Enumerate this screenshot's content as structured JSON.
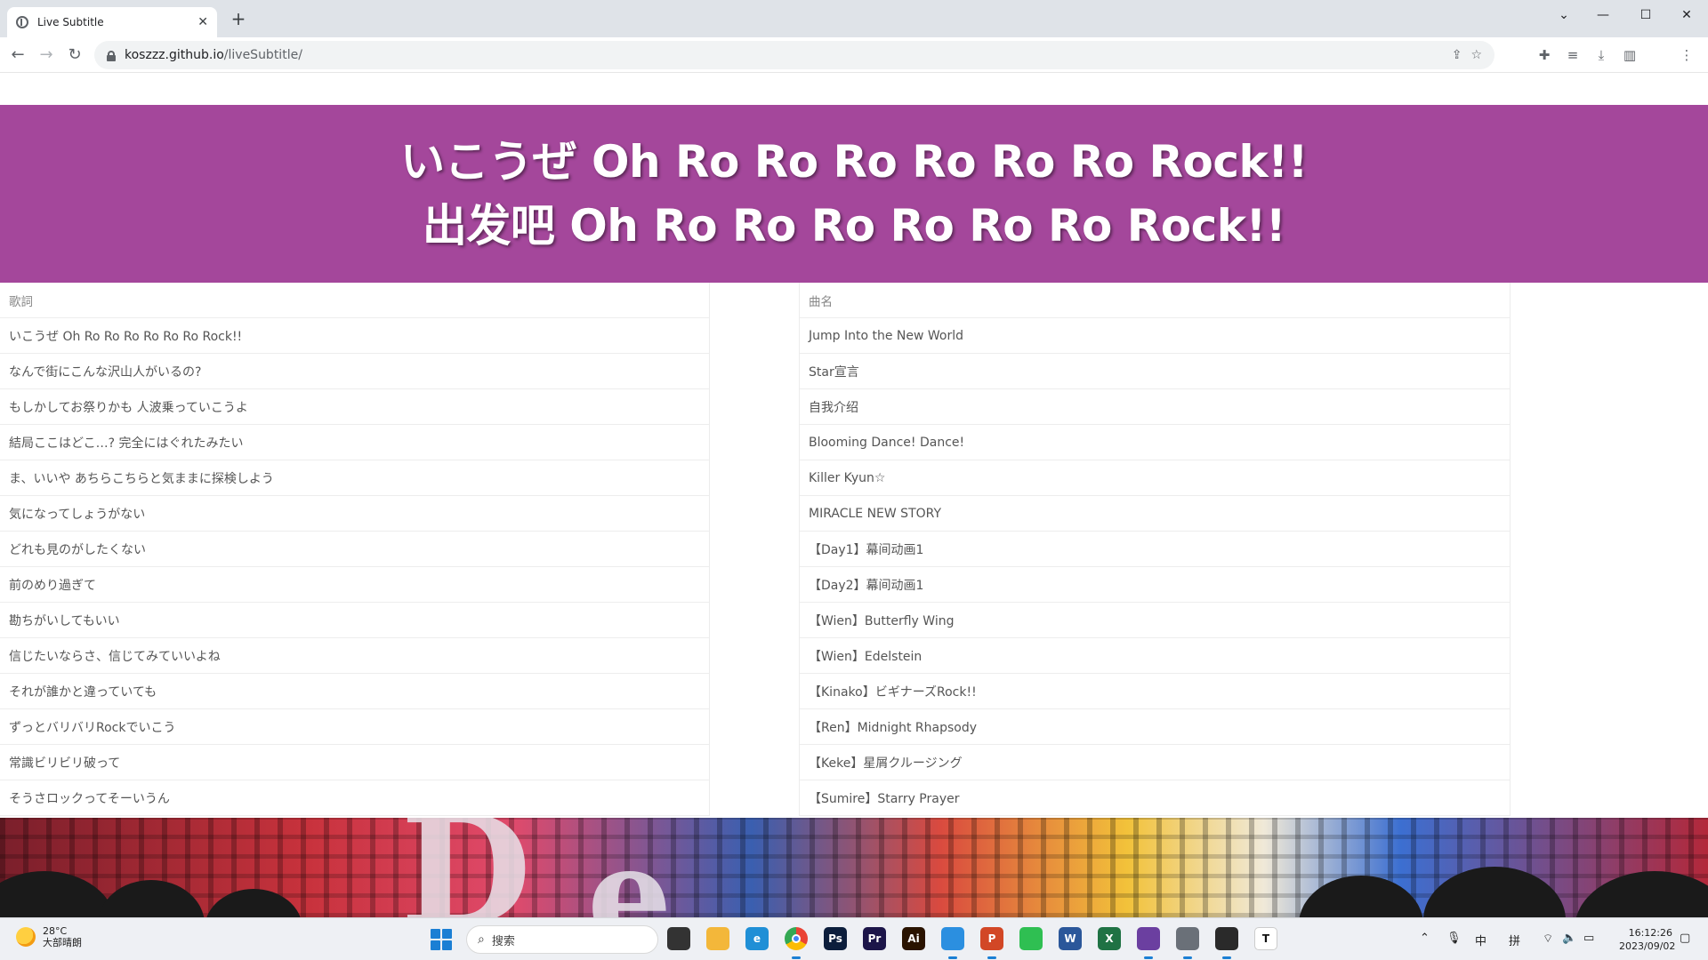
{
  "browser": {
    "tab_title": "Live Subtitle",
    "url_domain": "koszzz.github.io",
    "url_path": "/liveSubtitle/"
  },
  "banner": {
    "line1": "いこうぜ Oh Ro Ro Ro Ro Ro Ro Rock!!",
    "line2": "出发吧 Oh Ro Ro Ro Ro Ro Ro Rock!!",
    "background_color": "#a4479b"
  },
  "lyrics_table": {
    "header": "歌詞",
    "rows": [
      "いこうぜ Oh Ro Ro Ro Ro Ro Ro Rock!!",
      "なんで街にこんな沢山人がいるの?",
      "もしかしてお祭りかも 人波乗っていこうよ",
      "結局ここはどこ…? 完全にはぐれたみたい",
      "ま、いいや あちらこちらと気ままに探検しよう",
      "気になってしょうがない",
      "どれも見のがしたくない",
      "前のめり過ぎて",
      "勘ちがいしてもいい",
      "信じたいならさ、信じてみていいよね",
      "それが誰かと違っていても",
      "ずっとバリバリRockでいこう",
      "常識ビリビリ破って",
      "そうさロックってそーいうん"
    ]
  },
  "songs_table": {
    "header": "曲名",
    "rows": [
      "Jump Into the New World",
      "Star宣言",
      "自我介绍",
      "Blooming Dance! Dance!",
      "Killer Kyun☆",
      "MIRACLE NEW STORY",
      "【Day1】幕间动画1",
      "【Day2】幕间动画1",
      "【Wien】Butterfly Wing",
      "【Wien】Edelstein",
      "【Kinako】ビギナーズRock!!",
      "【Ren】Midnight Rhapsody",
      "【Keke】星屑クルージング",
      "【Sumire】Starry Prayer"
    ]
  },
  "taskbar": {
    "temperature": "28°C",
    "weather_desc": "大部晴朗",
    "search_placeholder": "搜索",
    "ime_lang": "中",
    "ime_mode": "拼",
    "time": "16:12:26",
    "date": "2023/09/02",
    "apps": [
      {
        "name": "task-view",
        "label": "",
        "color": "#333333"
      },
      {
        "name": "file-explorer",
        "label": "",
        "color": "#f3b73a"
      },
      {
        "name": "edge",
        "label": "e",
        "color": "#1f8fd6"
      },
      {
        "name": "chrome",
        "label": "",
        "color": "#ffffff"
      },
      {
        "name": "photoshop",
        "label": "Ps",
        "color": "#0c1e3c"
      },
      {
        "name": "premiere",
        "label": "Pr",
        "color": "#1c1549"
      },
      {
        "name": "illustrator",
        "label": "Ai",
        "color": "#2a1300"
      },
      {
        "name": "vscode",
        "label": "",
        "color": "#2b8fe0"
      },
      {
        "name": "powerpoint",
        "label": "P",
        "color": "#d24726"
      },
      {
        "name": "wechat",
        "label": "",
        "color": "#2fbf52"
      },
      {
        "name": "word",
        "label": "W",
        "color": "#2b579a"
      },
      {
        "name": "excel",
        "label": "X",
        "color": "#1f7244"
      },
      {
        "name": "obs-like",
        "label": "",
        "color": "#6b3fa0"
      },
      {
        "name": "settings",
        "label": "",
        "color": "#6a7078"
      },
      {
        "name": "app-circle",
        "label": "",
        "color": "#2a2a2a"
      },
      {
        "name": "typora",
        "label": "T",
        "color": "#ffffff"
      }
    ]
  }
}
